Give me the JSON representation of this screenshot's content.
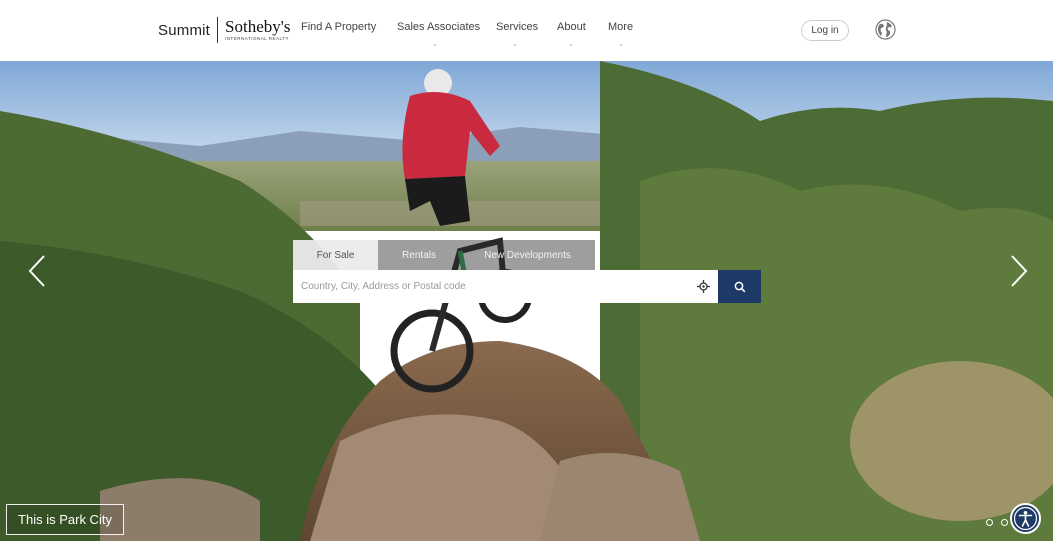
{
  "brand": {
    "summit": "Summit",
    "sothebys": "Sotheby's",
    "subtitle": "INTERNATIONAL REALTY"
  },
  "nav": {
    "find_property": "Find A Property",
    "sales_associates": "Sales Associates",
    "services": "Services",
    "about": "About",
    "more": "More"
  },
  "header": {
    "login_label": "Log in",
    "globe_icon": "globe-icon"
  },
  "search": {
    "tabs": [
      "For Sale",
      "Rentals",
      "New Developments"
    ],
    "active_tab": "For Sale",
    "placeholder": "Country, City, Address or Postal code",
    "value": "",
    "locate_icon": "crosshair-icon",
    "button_icon": "search-icon"
  },
  "hero": {
    "caption": "This is Park City",
    "slide_count": 2,
    "prev_icon": "chevron-left-icon",
    "next_icon": "chevron-right-icon"
  },
  "accessibility": {
    "icon": "accessibility-icon"
  },
  "colors": {
    "brand_navy": "#1d3a67",
    "header_bg": "#ffffff"
  }
}
